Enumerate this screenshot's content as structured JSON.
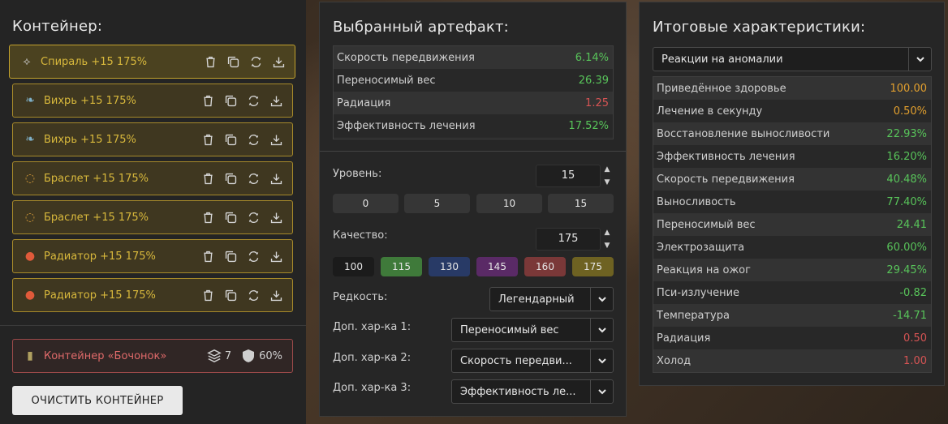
{
  "left": {
    "title": "Контейнер:",
    "items": [
      {
        "label": "Спираль +15 175%",
        "icon": "spiral-artifact-icon",
        "glyph": "⟡",
        "color": "#c8c8c8"
      },
      {
        "label": "Вихрь +15 175%",
        "icon": "vortex-artifact-icon",
        "glyph": "❧",
        "color": "#7fb0c8"
      },
      {
        "label": "Вихрь +15 175%",
        "icon": "vortex-artifact-icon",
        "glyph": "❧",
        "color": "#7fb0c8"
      },
      {
        "label": "Браслет +15 175%",
        "icon": "bracelet-artifact-icon",
        "glyph": "◌",
        "color": "#d49a3a"
      },
      {
        "label": "Браслет +15 175%",
        "icon": "bracelet-artifact-icon",
        "glyph": "◌",
        "color": "#d49a3a"
      },
      {
        "label": "Радиатор +15 175%",
        "icon": "radiator-artifact-icon",
        "glyph": "●",
        "color": "#e05a3a"
      },
      {
        "label": "Радиатор +15 175%",
        "icon": "radiator-artifact-icon",
        "glyph": "●",
        "color": "#e05a3a"
      }
    ],
    "container": {
      "label": "Контейнер «Бочонок»",
      "slots": "7",
      "protection": "60%"
    },
    "clear_button": "ОЧИСТИТЬ КОНТЕЙНЕР"
  },
  "middle": {
    "title": "Выбранный артефакт:",
    "stats": [
      {
        "name": "Скорость передвижения",
        "value": "6.14%",
        "tone": "green"
      },
      {
        "name": "Переносимый вес",
        "value": "26.39",
        "tone": "green"
      },
      {
        "name": "Радиация",
        "value": "1.25",
        "tone": "red"
      },
      {
        "name": "Эффективность лечения",
        "value": "17.52%",
        "tone": "green"
      }
    ],
    "level_label": "Уровень:",
    "level_value": "15",
    "level_presets": [
      "0",
      "5",
      "10",
      "15"
    ],
    "quality_label": "Качество:",
    "quality_value": "175",
    "quality_presets": [
      {
        "label": "100",
        "color": "#1b1b1b"
      },
      {
        "label": "115",
        "color": "#3f7a3a"
      },
      {
        "label": "130",
        "color": "#283a66"
      },
      {
        "label": "145",
        "color": "#5a2a66"
      },
      {
        "label": "160",
        "color": "#7a3838"
      },
      {
        "label": "175",
        "color": "#6e6222"
      }
    ],
    "rarity_label": "Редкость:",
    "rarity_value": "Легендарный",
    "extra1_label": "Доп. хар-ка 1:",
    "extra1_value": "Переносимый вес",
    "extra2_label": "Доп. хар-ка 2:",
    "extra2_value": "Скорость передви...",
    "extra3_label": "Доп. хар-ка 3:",
    "extra3_value": "Эффективность ле..."
  },
  "right": {
    "title": "Итоговые характеристики:",
    "filter_value": "Реакции на аномалии",
    "stats": [
      {
        "name": "Приведённое здоровье",
        "value": "100.00",
        "tone": "orange"
      },
      {
        "name": "Лечение в секунду",
        "value": "0.50%",
        "tone": "orange"
      },
      {
        "name": "Восстановление выносливости",
        "value": "22.93%",
        "tone": "green"
      },
      {
        "name": "Эффективность лечения",
        "value": "16.20%",
        "tone": "green"
      },
      {
        "name": "Скорость передвижения",
        "value": "40.48%",
        "tone": "green"
      },
      {
        "name": "Выносливость",
        "value": "77.40%",
        "tone": "green"
      },
      {
        "name": "Переносимый вес",
        "value": "24.41",
        "tone": "green"
      },
      {
        "name": "Электрозащита",
        "value": "60.00%",
        "tone": "green"
      },
      {
        "name": "Реакция на ожог",
        "value": "29.45%",
        "tone": "green"
      },
      {
        "name": "Пси-излучение",
        "value": "-0.82",
        "tone": "green"
      },
      {
        "name": "Температура",
        "value": "-14.71",
        "tone": "green"
      },
      {
        "name": "Радиация",
        "value": "0.50",
        "tone": "red"
      },
      {
        "name": "Холод",
        "value": "1.00",
        "tone": "red"
      }
    ]
  }
}
